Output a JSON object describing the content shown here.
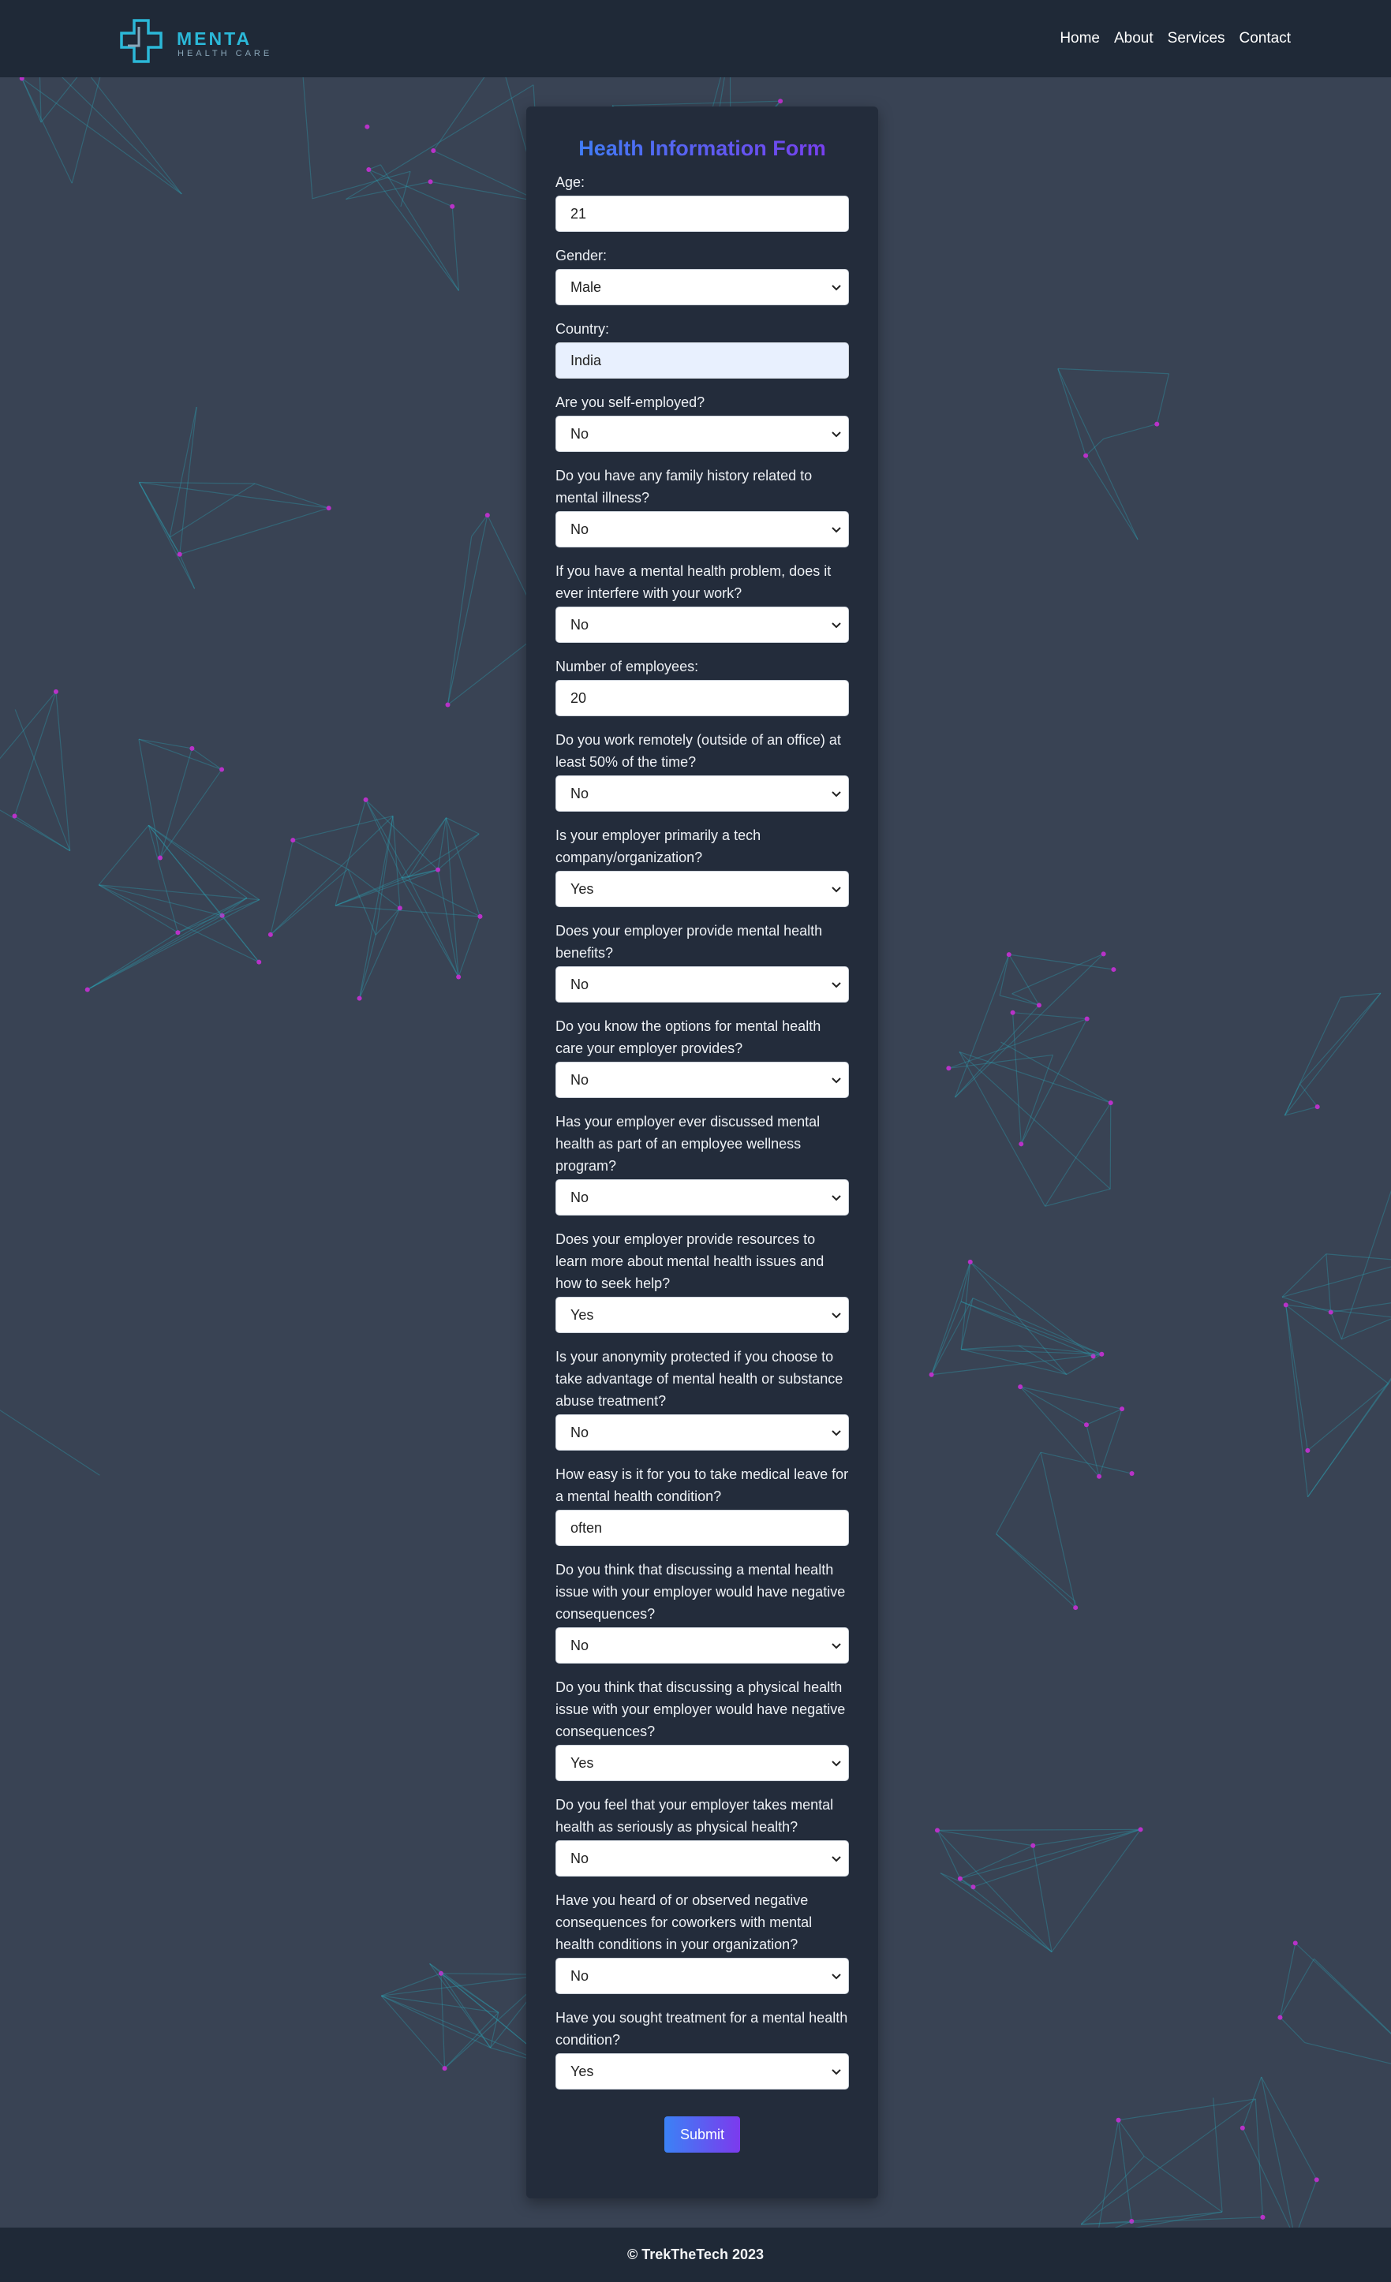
{
  "brand": {
    "name": "MENTA",
    "tagline": "HEALTH CARE",
    "accent": "#2bb8d8"
  },
  "nav": [
    {
      "label": "Home"
    },
    {
      "label": "About"
    },
    {
      "label": "Services"
    },
    {
      "label": "Contact"
    }
  ],
  "form": {
    "title": "Health Information Form",
    "fields": [
      {
        "label": "Age:",
        "type": "input",
        "value": "21"
      },
      {
        "label": "Gender:",
        "type": "select",
        "value": "Male"
      },
      {
        "label": "Country:",
        "type": "input",
        "value": "India",
        "autofill": true
      },
      {
        "label": "Are you self-employed?",
        "type": "select",
        "value": "No"
      },
      {
        "label": "Do you have any family history related to mental illness?",
        "type": "select",
        "value": "No"
      },
      {
        "label": "If you have a mental health problem, does it ever interfere with your work?",
        "type": "select",
        "value": "No"
      },
      {
        "label": "Number of employees:",
        "type": "input",
        "value": "20"
      },
      {
        "label": "Do you work remotely (outside of an office) at least 50% of the time?",
        "type": "select",
        "value": "No"
      },
      {
        "label": "Is your employer primarily a tech company/organization?",
        "type": "select",
        "value": "Yes"
      },
      {
        "label": "Does your employer provide mental health benefits?",
        "type": "select",
        "value": "No"
      },
      {
        "label": "Do you know the options for mental health care your employer provides?",
        "type": "select",
        "value": "No"
      },
      {
        "label": "Has your employer ever discussed mental health as part of an employee wellness program?",
        "type": "select",
        "value": "No"
      },
      {
        "label": "Does your employer provide resources to learn more about mental health issues and how to seek help?",
        "type": "select",
        "value": "Yes"
      },
      {
        "label": "Is your anonymity protected if you choose to take advantage of mental health or substance abuse treatment?",
        "type": "select",
        "value": "No"
      },
      {
        "label": "How easy is it for you to take medical leave for a mental health condition?",
        "type": "input",
        "value": "often"
      },
      {
        "label": "Do you think that discussing a mental health issue with your employer would have negative consequences?",
        "type": "select",
        "value": "No"
      },
      {
        "label": "Do you think that discussing a physical health issue with your employer would have negative consequences?",
        "type": "select",
        "value": "Yes"
      },
      {
        "label": "Do you feel that your employer takes mental health as seriously as physical health?",
        "type": "select",
        "value": "No"
      },
      {
        "label": "Have you heard of or observed negative consequences for coworkers with mental health conditions in your organization?",
        "type": "select",
        "value": "No"
      },
      {
        "label": "Have you sought treatment for a mental health condition?",
        "type": "select",
        "value": "Yes"
      }
    ],
    "submit_label": "Submit"
  },
  "footer": {
    "text": "©  TrekTheTech 2023"
  },
  "colors": {
    "background": "#394354",
    "navbar": "#1f2937",
    "card": "#232c3b",
    "gradient_start": "#3b82f6",
    "gradient_end": "#7c3aed"
  }
}
